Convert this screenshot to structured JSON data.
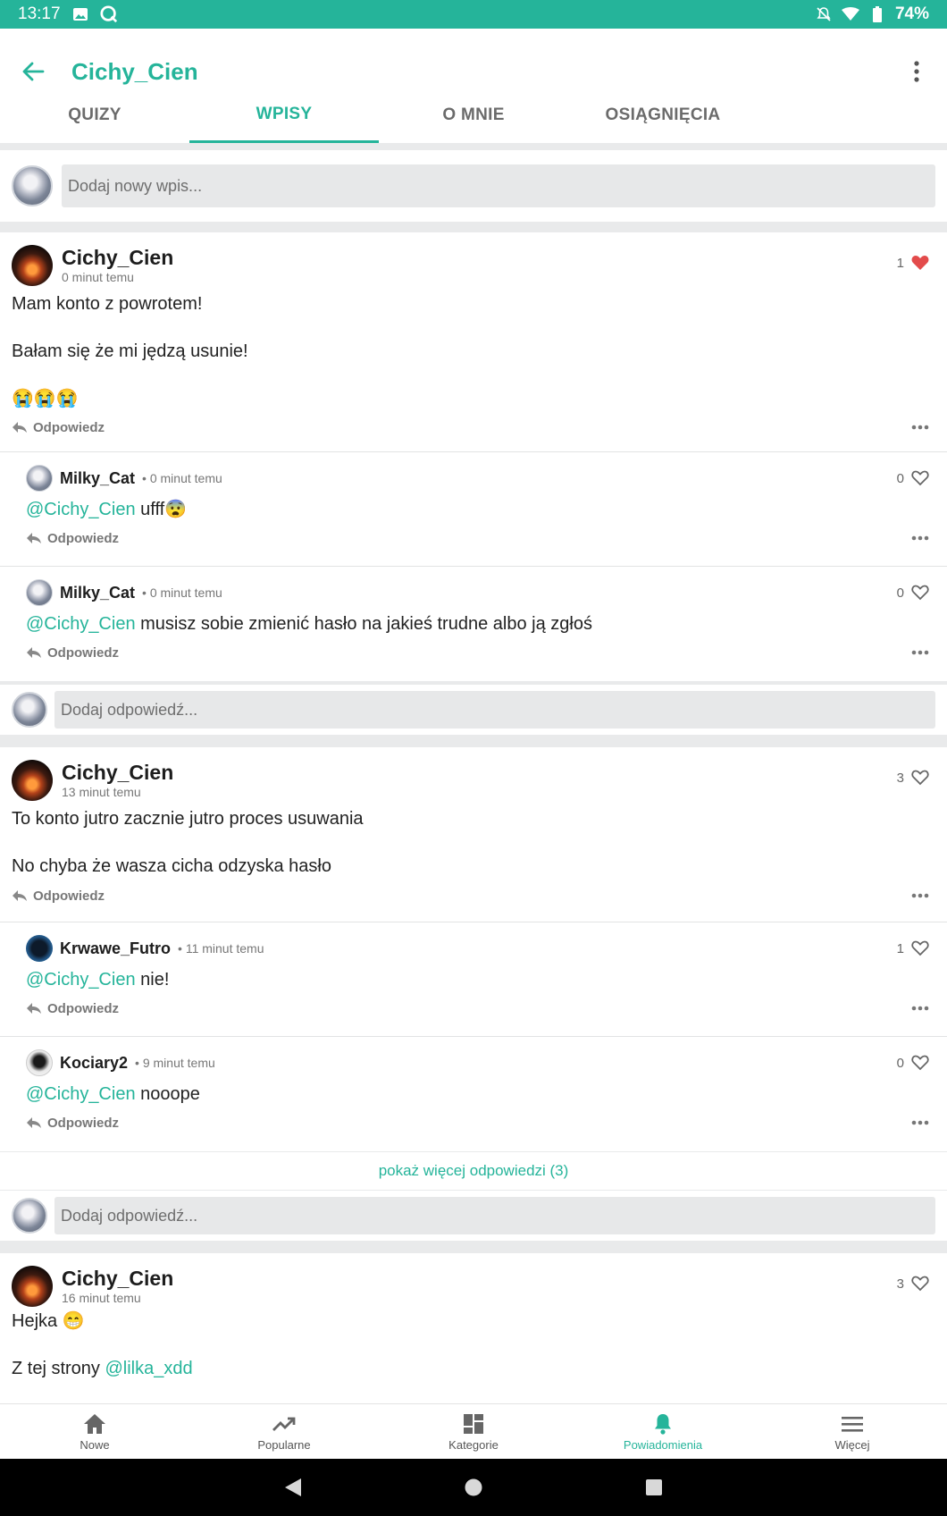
{
  "status": {
    "time": "13:17",
    "battery": "74%"
  },
  "appbar": {
    "title": "Cichy_Cien"
  },
  "tabs": [
    "QUIZY",
    "WPISY",
    "O MNIE",
    "OSIĄGNIĘCIA"
  ],
  "new_post": {
    "placeholder": "Dodaj nowy wpis..."
  },
  "reply_label": "Odpowiedz",
  "add_reply_placeholder": "Dodaj odpowiedź...",
  "posts": [
    {
      "author": "Cichy_Cien",
      "time": "0 minut temu",
      "likes": "1",
      "line1": "Mam konto z powrotem!",
      "line2": "Bałam się że mi jędzą usunie!",
      "line3": "😭😭😭",
      "comments": [
        {
          "author": "Milky_Cat",
          "time": "• 0 minut temu",
          "likes": "0",
          "mention": "@Cichy_Cien",
          "text": " ufff😨"
        },
        {
          "author": "Milky_Cat",
          "time": "• 0 minut temu",
          "likes": "0",
          "mention": "@Cichy_Cien",
          "text": " musisz sobie zmienić hasło na jakieś trudne albo ją zgłoś"
        }
      ]
    },
    {
      "author": "Cichy_Cien",
      "time": "13 minut temu",
      "likes": "3",
      "line1": "To konto jutro zacznie jutro proces usuwania",
      "line2": "No chyba że wasza cicha odzyska hasło",
      "comments": [
        {
          "author": "Krwawe_Futro",
          "time": "• 11 minut temu",
          "likes": "1",
          "mention": "@Cichy_Cien",
          "text": " nie!"
        },
        {
          "author": "Kociary2",
          "time": "• 9 minut temu",
          "likes": "0",
          "mention": "@Cichy_Cien",
          "text": " nooope"
        }
      ],
      "show_more": "pokaż więcej odpowiedzi (3)"
    },
    {
      "author": "Cichy_Cien",
      "time": "16 minut temu",
      "likes": "3",
      "line1": "Hejka 😁",
      "line2_prefix": "Z tej strony ",
      "line2_mention": "@lilka_xdd"
    }
  ],
  "bottom_nav": [
    {
      "label": "Nowe",
      "icon": "home-icon"
    },
    {
      "label": "Popularne",
      "icon": "trending-icon"
    },
    {
      "label": "Kategorie",
      "icon": "dashboard-icon"
    },
    {
      "label": "Powiadomienia",
      "icon": "bell-icon",
      "active": true
    },
    {
      "label": "Więcej",
      "icon": "menu-icon"
    }
  ],
  "colors": {
    "accent": "#25b49a",
    "heart_filled": "#e34b4b"
  }
}
